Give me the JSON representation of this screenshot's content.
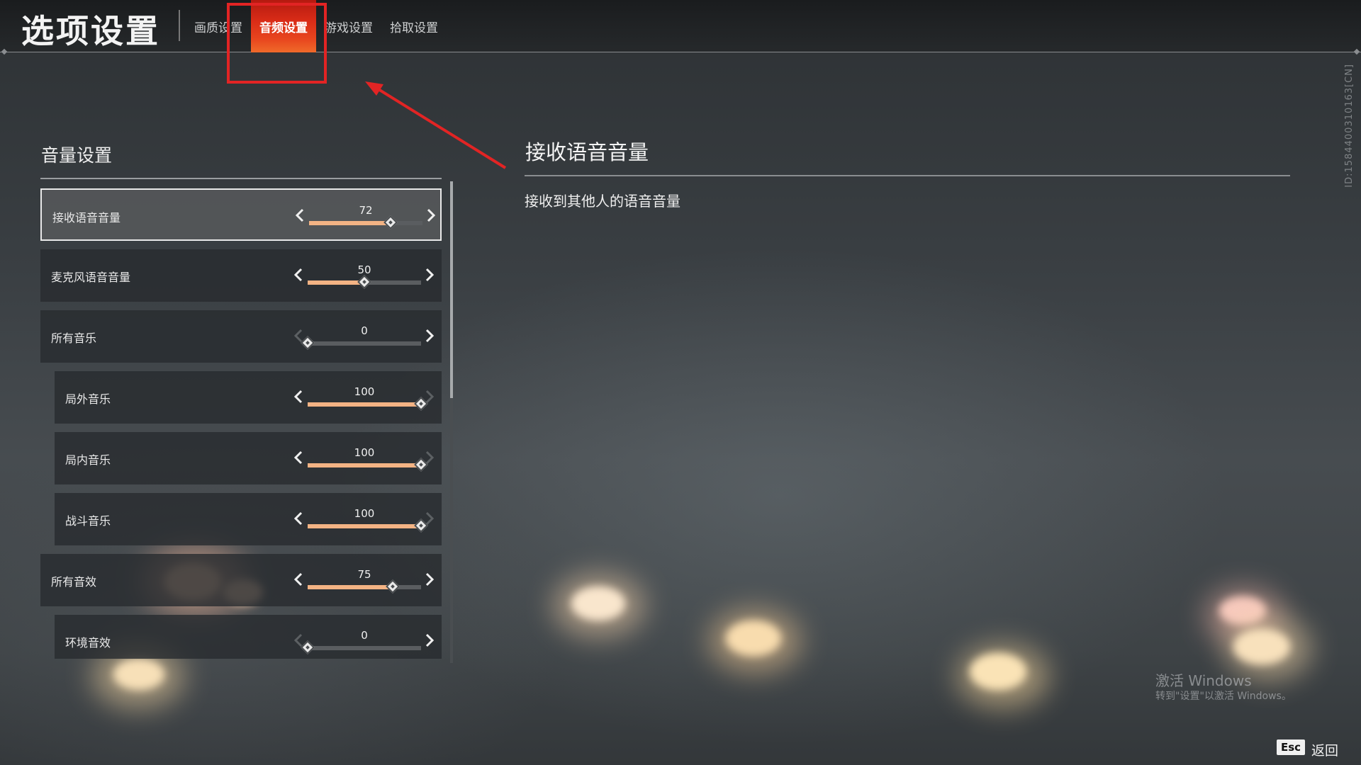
{
  "header": {
    "title": "选项设置",
    "tabs": [
      {
        "label": "画质设置",
        "active": false
      },
      {
        "label": "音频设置",
        "active": true
      },
      {
        "label": "游戏设置",
        "active": false
      },
      {
        "label": "拾取设置",
        "active": false
      }
    ]
  },
  "volume_section": {
    "title": "音量设置",
    "rows": [
      {
        "label": "接收语音音量",
        "value": "72",
        "level": 0.72,
        "selected": true,
        "left_enabled": true,
        "right_enabled": true
      },
      {
        "label": "麦克风语音音量",
        "value": "50",
        "level": 0.5,
        "selected": false,
        "left_enabled": true,
        "right_enabled": true
      },
      {
        "label": "所有音乐",
        "value": "0",
        "level": 0,
        "selected": false,
        "left_enabled": false,
        "right_enabled": true
      },
      {
        "label": "局外音乐",
        "value": "100",
        "level": 1,
        "selected": false,
        "left_enabled": true,
        "right_enabled": false
      },
      {
        "label": "局内音乐",
        "value": "100",
        "level": 1,
        "selected": false,
        "left_enabled": true,
        "right_enabled": false
      },
      {
        "label": "战斗音乐",
        "value": "100",
        "level": 1,
        "selected": false,
        "left_enabled": true,
        "right_enabled": false
      },
      {
        "label": "所有音效",
        "value": "75",
        "level": 0.75,
        "selected": false,
        "left_enabled": true,
        "right_enabled": true
      },
      {
        "label": "环境音效",
        "value": "0",
        "level": 0,
        "selected": false,
        "left_enabled": false,
        "right_enabled": true
      }
    ]
  },
  "detail": {
    "title": "接收语音音量",
    "description": "接收到其他人的语音音量"
  },
  "side_id": "ID:1584400310163[CN]",
  "watermark": {
    "line1": "激活 Windows",
    "line2": "转到\"设置\"以激活 Windows。"
  },
  "footer": {
    "esc_key": "Esc",
    "esc_label": "返回"
  },
  "colors": {
    "accent_fill": "#f3b384",
    "active_tab": "#d92c17",
    "annotation_red": "#e22424"
  }
}
